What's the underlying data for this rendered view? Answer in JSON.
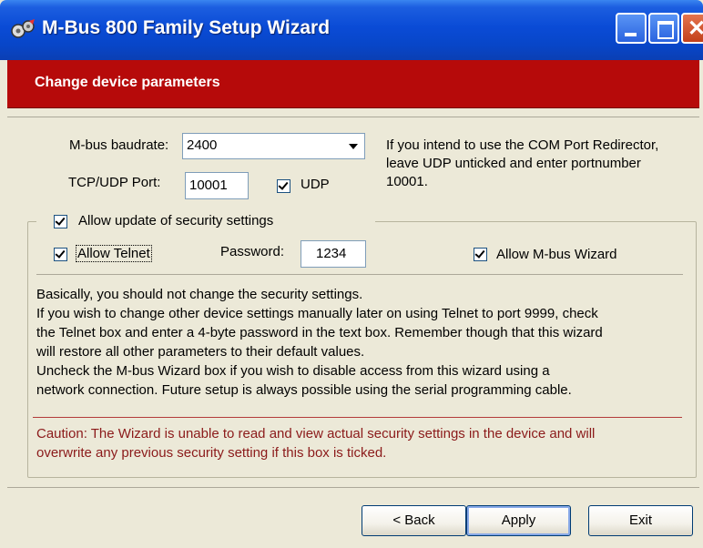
{
  "window": {
    "title": "M-Bus 800 Family Setup Wizard",
    "icon": "wizard-app-icon"
  },
  "header": {
    "title": "Change device parameters"
  },
  "params": {
    "baudrate_label": "M-bus baudrate:",
    "baudrate_value": "2400",
    "port_label": "TCP/UDP Port:",
    "port_value": "10001",
    "udp_label": "UDP",
    "udp_checked": true,
    "hint": [
      "If you intend to use the COM Port Redirector,",
      "leave UDP unticked and enter portnumber",
      "10001."
    ]
  },
  "security": {
    "group_label": "Allow update of security settings",
    "group_checked": true,
    "telnet_label": "Allow Telnet",
    "telnet_checked": true,
    "password_label": "Password:",
    "password_value": "1234",
    "wizard_label": "Allow M-bus Wizard",
    "wizard_checked": true,
    "description": [
      "Basically, you should not change the security settings.",
      "If you wish to change other device settings manually later on using Telnet to port 9999, check",
      "the Telnet box and enter a 4-byte password in the text box. Remember though that this wizard",
      "will restore all other parameters to their default values.",
      "Uncheck the M-bus Wizard box if you wish to disable access from this wizard using a",
      "network connection. Future setup is always possible using the serial programming cable."
    ],
    "caution": [
      "Caution: The Wizard is unable to read and view actual security settings in the device and will",
      "overwrite any previous security setting if this box is ticked."
    ]
  },
  "buttons": {
    "back": "< Back",
    "apply": "Apply",
    "exit": "Exit"
  },
  "colors": {
    "header_bg": "#b60a0a",
    "titlebar": "#0a4bd6",
    "caution": "#8b1a1a"
  }
}
